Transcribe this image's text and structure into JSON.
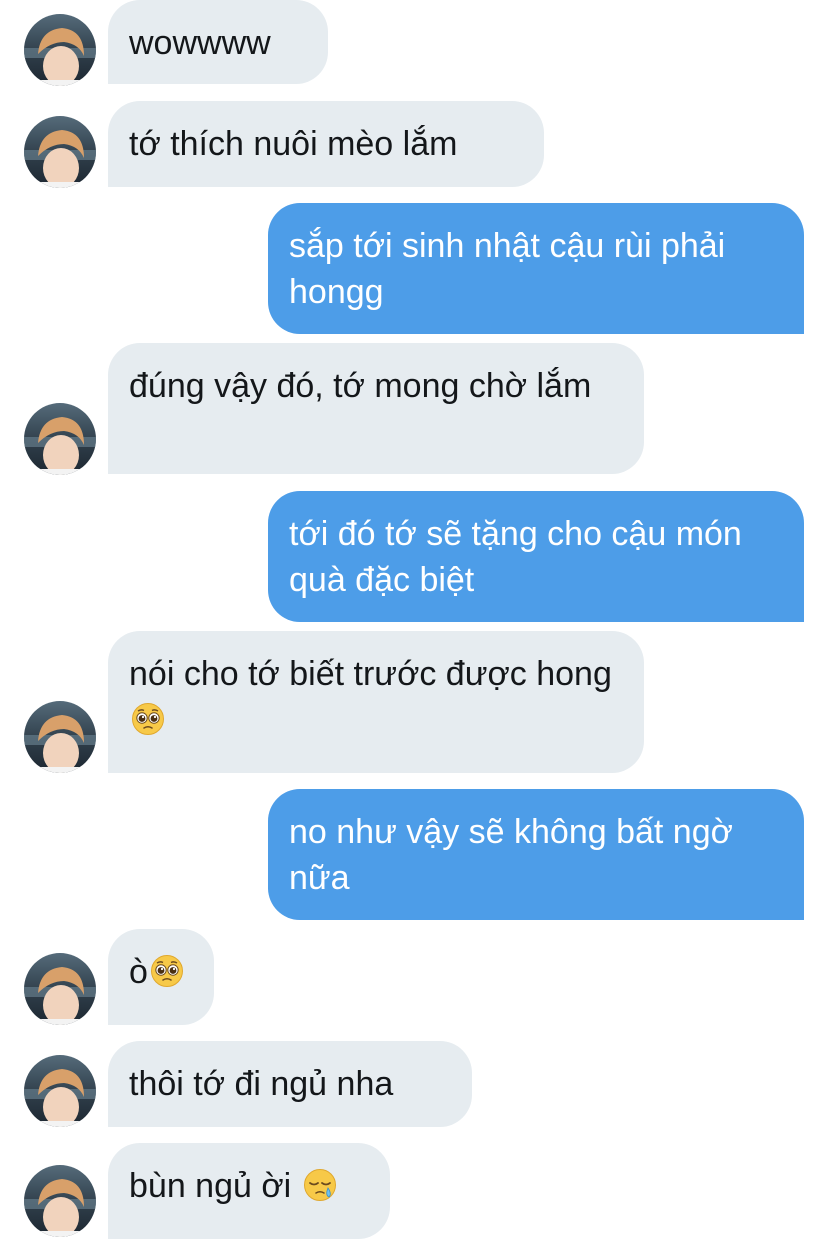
{
  "conversation": {
    "messages": [
      {
        "direction": "in",
        "text": "wowwww",
        "emoji": ""
      },
      {
        "direction": "in",
        "text": "tớ thích nuôi mèo lắm",
        "emoji": ""
      },
      {
        "direction": "out",
        "text": "sắp tới sinh nhật cậu rùi phải hongg",
        "emoji": ""
      },
      {
        "direction": "in",
        "text": "đúng vậy đó, tớ mong chờ lắm",
        "emoji": ""
      },
      {
        "direction": "out",
        "text": "tới đó tớ sẽ tặng cho cậu món quà đặc biệt",
        "emoji": ""
      },
      {
        "direction": "in",
        "text": "nói cho tớ biết trước được hong ",
        "emoji": "pleading-face-icon"
      },
      {
        "direction": "out",
        "text": "no như vậy sẽ không bất ngờ nữa",
        "emoji": ""
      },
      {
        "direction": "in",
        "text": "ò",
        "emoji": "pleading-face-icon"
      },
      {
        "direction": "in",
        "text": "thôi tớ đi ngủ nha",
        "emoji": ""
      },
      {
        "direction": "in",
        "text": "bùn ngủ ời ",
        "emoji": "sleepy-face-icon"
      }
    ]
  },
  "colors": {
    "incoming_bubble": "#e6ecf0",
    "outgoing_bubble": "#4d9de8",
    "incoming_text": "#14171a",
    "outgoing_text": "#ffffff"
  }
}
